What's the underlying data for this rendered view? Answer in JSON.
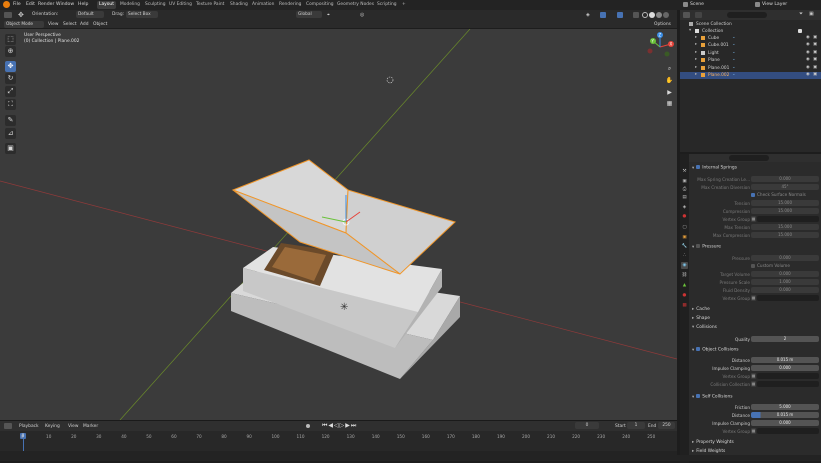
{
  "topbar": {
    "menus": [
      "File",
      "Edit",
      "Render",
      "Window",
      "Help"
    ],
    "workspaces": [
      "Layout",
      "Modeling",
      "Sculpting",
      "UV Editing",
      "Texture Paint",
      "Shading",
      "Animation",
      "Rendering",
      "Compositing",
      "Geometry Nodes",
      "Scripting"
    ],
    "scene": "Scene",
    "view_layer": "View Layer"
  },
  "viewport_header": {
    "orientation_label": "Orientation:",
    "orientation_value": "Default",
    "drag_label": "Drag:",
    "drag_value": "Select Box",
    "mode": "Object Mode",
    "menus": [
      "View",
      "Select",
      "Add",
      "Object"
    ],
    "transform": "Global",
    "options": "Options"
  },
  "viewport_overlay": {
    "view_name": "User Perspective",
    "context": "(0) Collection | Plane.002"
  },
  "gizmo": {
    "x": "X",
    "y": "Y",
    "z": "Z"
  },
  "timeline": {
    "menus": [
      "Playback",
      "Keying",
      "View",
      "Marker"
    ],
    "current_frame": "0",
    "start_label": "Start",
    "start": "1",
    "end_label": "End",
    "end": "250",
    "frame_indicator": "0",
    "ticks": [
      "0",
      "10",
      "20",
      "30",
      "40",
      "50",
      "60",
      "70",
      "80",
      "90",
      "100",
      "110",
      "120",
      "130",
      "140",
      "150",
      "160",
      "170",
      "180",
      "190",
      "200",
      "210",
      "220",
      "230",
      "240",
      "250"
    ]
  },
  "outliner": {
    "root": "Scene Collection",
    "collection": "Collection",
    "items": [
      "Cube",
      "Cube.001",
      "Light",
      "Plane",
      "Plane.001",
      "Plane.002"
    ]
  },
  "properties": {
    "internal_springs": "Internal Springs",
    "max_spring_creation_length_label": "Max Spring Creation Le...",
    "max_spring_creation_length": "0.000",
    "max_creation_diversion_label": "Max Creation Diversion",
    "max_creation_diversion": "45°",
    "check_surface_normals": "Check Surface Normals",
    "tension_label": "Tension",
    "tension": "15.000",
    "compression_label": "Compression",
    "compression": "15.000",
    "vertex_group_label": "Vertex Group",
    "max_tension_label": "Max Tension",
    "max_tension": "15.000",
    "max_compression_label": "Max Compression",
    "max_compression": "15.000",
    "pressure": "Pressure",
    "pressure_label": "Pressure",
    "pressure_value": "0.000",
    "custom_volume": "Custom Volume",
    "target_volume_label": "Target Volume",
    "target_volume": "0.000",
    "pressure_scale_label": "Pressure Scale",
    "pressure_scale": "1.000",
    "fluid_density_label": "Fluid Density",
    "fluid_density": "0.000",
    "pressure_vertex_group_label": "Vertex Group",
    "cache": "Cache",
    "shape": "Shape",
    "collisions": "Collisions",
    "quality_label": "Quality",
    "quality": "2",
    "object_collisions": "Object Collisions",
    "distance_label": "Distance",
    "distance": "0.015 m",
    "impulse_clamping_label": "Impulse Clamping",
    "impulse_clamping": "0.000",
    "obj_vertex_group_label": "Vertex Group",
    "collision_collection_label": "Collision Collection",
    "self_collisions": "Self Collisions",
    "friction_label": "Friction",
    "friction": "5.000",
    "self_distance_label": "Distance",
    "self_distance": "0.015 m",
    "self_impulse_clamping_label": "Impulse Clamping",
    "self_impulse_clamping": "0.000",
    "self_vertex_group_label": "Vertex Group",
    "property_weights": "Property Weights",
    "field_weights": "Field Weights"
  },
  "colors": {
    "accent": "#4772b3",
    "selection_outline": "#f0962a",
    "grid_x": "#8f3a3a",
    "grid_y": "#6a8a2a"
  }
}
